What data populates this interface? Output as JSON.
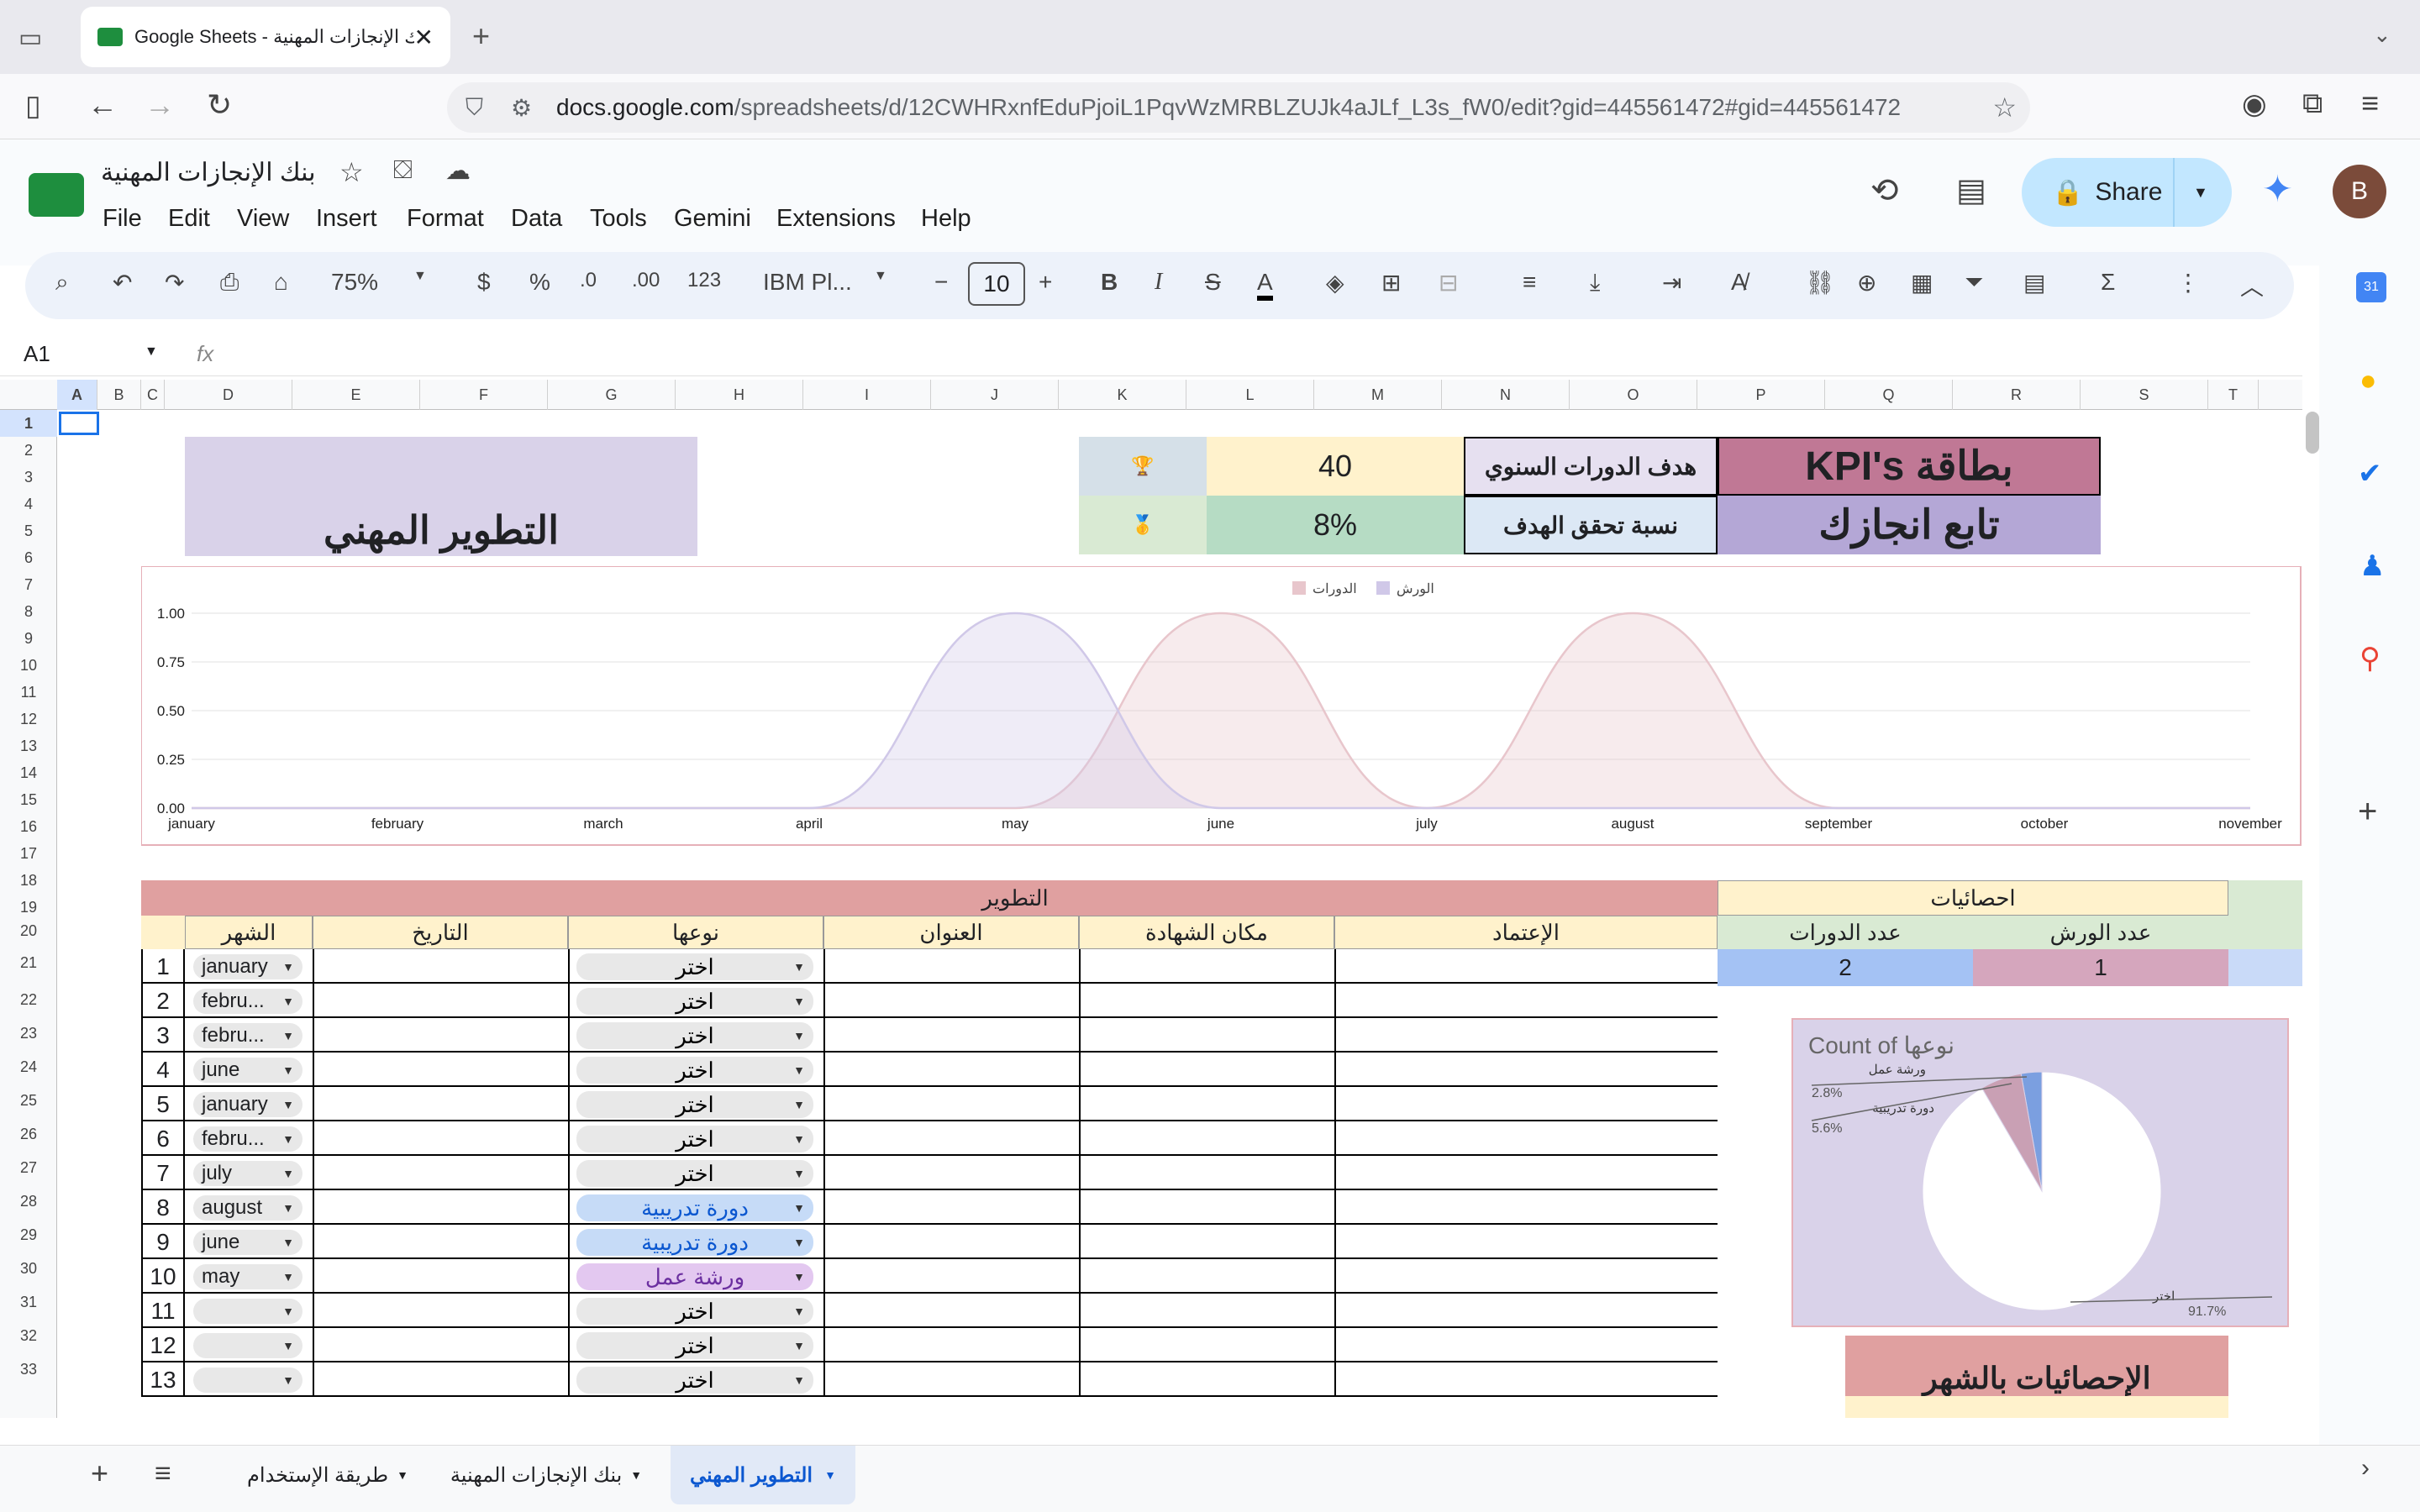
{
  "browser": {
    "tab_title": "Google Sheets - بنك الإنجازات المهنية",
    "url_host": "docs.google.com",
    "url_path": "/spreadsheets/d/12CWHRxnfEduPjoiL1PqvWzMRBLZUJk4aJLf_L3s_fW0/edit?gid=445561472#gid=445561472"
  },
  "doc": {
    "title": "بنك الإنجازات المهنية",
    "share": "Share",
    "avatar": "B"
  },
  "menu": [
    "File",
    "Edit",
    "View",
    "Insert",
    "Format",
    "Data",
    "Tools",
    "Gemini",
    "Extensions",
    "Help"
  ],
  "toolbar": {
    "zoom": "75%",
    "currency": "$",
    "percent": "%",
    "dec_minus": ".0",
    "dec_plus": ".00",
    "num_fmt": "123",
    "font": "IBM Pl...",
    "font_size": "10",
    "bold": "B",
    "italic": "I"
  },
  "namebox": "A1",
  "fx": "fx",
  "columns": [
    "A",
    "B",
    "C",
    "D",
    "E",
    "F",
    "G",
    "H",
    "I",
    "J",
    "K",
    "L",
    "M",
    "N",
    "O",
    "P",
    "Q",
    "R",
    "S",
    "T"
  ],
  "rows": [
    "1",
    "2",
    "3",
    "4",
    "5",
    "6",
    "7",
    "8",
    "9",
    "10",
    "11",
    "12",
    "13",
    "14",
    "15",
    "16",
    "17",
    "18",
    "19",
    "20",
    "21",
    "22",
    "23",
    "24",
    "25",
    "26",
    "27",
    "28",
    "29",
    "30",
    "31",
    "32",
    "33"
  ],
  "kpi": {
    "card_title": "KPI's بطاقة",
    "track": "تابع انجازك",
    "annual_goal_label": "هدف الدورات السنوي",
    "annual_goal": "40",
    "achieve_label": "نسبة تحقق الهدف",
    "achieve": "8%",
    "trophy": "🏆",
    "medal": "🥇",
    "section_title": "التطوير المهني"
  },
  "chart_data": {
    "type": "area",
    "x": [
      "january",
      "february",
      "march",
      "april",
      "may",
      "june",
      "july",
      "august",
      "september",
      "october",
      "november"
    ],
    "series": [
      {
        "name": "الدورات",
        "values": [
          0,
          0,
          0,
          0,
          0,
          1,
          0,
          1,
          0,
          0,
          0
        ]
      },
      {
        "name": "الورش",
        "values": [
          0,
          0,
          0,
          0,
          1,
          0,
          0,
          0,
          0,
          0,
          0
        ]
      }
    ],
    "yticks": [
      "1.00",
      "0.75",
      "0.50",
      "0.25",
      "0.00"
    ],
    "ylim": [
      0,
      1
    ],
    "legend": "top",
    "colors": [
      "#e8c6cc",
      "#d0c8e8"
    ]
  },
  "table": {
    "group_header": "التطوير",
    "stats_header": "احصائيات",
    "headers": {
      "month": "الشهر",
      "date": "التاريخ",
      "type": "نوعها",
      "title": "العنوان",
      "place": "مكان الشهادة",
      "accreditation": "الإعتماد",
      "courses_count": "عدد الدورات",
      "workshops_count": "عدد الورش"
    },
    "courses_count": "2",
    "workshops_count": "1",
    "rows": [
      {
        "n": "1",
        "month": "january",
        "type": "اختر"
      },
      {
        "n": "2",
        "month": "febru...",
        "type": "اختر"
      },
      {
        "n": "3",
        "month": "febru...",
        "type": "اختر"
      },
      {
        "n": "4",
        "month": "june",
        "type": "اختر"
      },
      {
        "n": "5",
        "month": "january",
        "type": "اختر"
      },
      {
        "n": "6",
        "month": "febru...",
        "type": "اختر"
      },
      {
        "n": "7",
        "month": "july",
        "type": "اختر"
      },
      {
        "n": "8",
        "month": "august",
        "type": "دورة تدريبية"
      },
      {
        "n": "9",
        "month": "june",
        "type": "دورة تدريبية"
      },
      {
        "n": "10",
        "month": "may",
        "type": "ورشة عمل"
      },
      {
        "n": "11",
        "month": "",
        "type": "اختر"
      },
      {
        "n": "12",
        "month": "",
        "type": "اختر"
      },
      {
        "n": "13",
        "month": "",
        "type": "اختر"
      }
    ]
  },
  "pie": {
    "title": "Count of نوعها",
    "slices": [
      {
        "label": "ورشة عمل",
        "pct": "2.8%",
        "value": 2.8,
        "color": "#7b9fe0"
      },
      {
        "label": "دورة تدريبية",
        "pct": "5.6%",
        "value": 5.6,
        "color": "#c9a0b4"
      },
      {
        "label": "اختر",
        "pct": "91.7%",
        "value": 91.7,
        "color": "#ffffff"
      }
    ]
  },
  "monthly_stats_title": "الإحصائيات بالشهر",
  "sheets": [
    "طريقة الإستخدام",
    "بنك الإنجازات المهنية",
    "التطوير المهني"
  ]
}
